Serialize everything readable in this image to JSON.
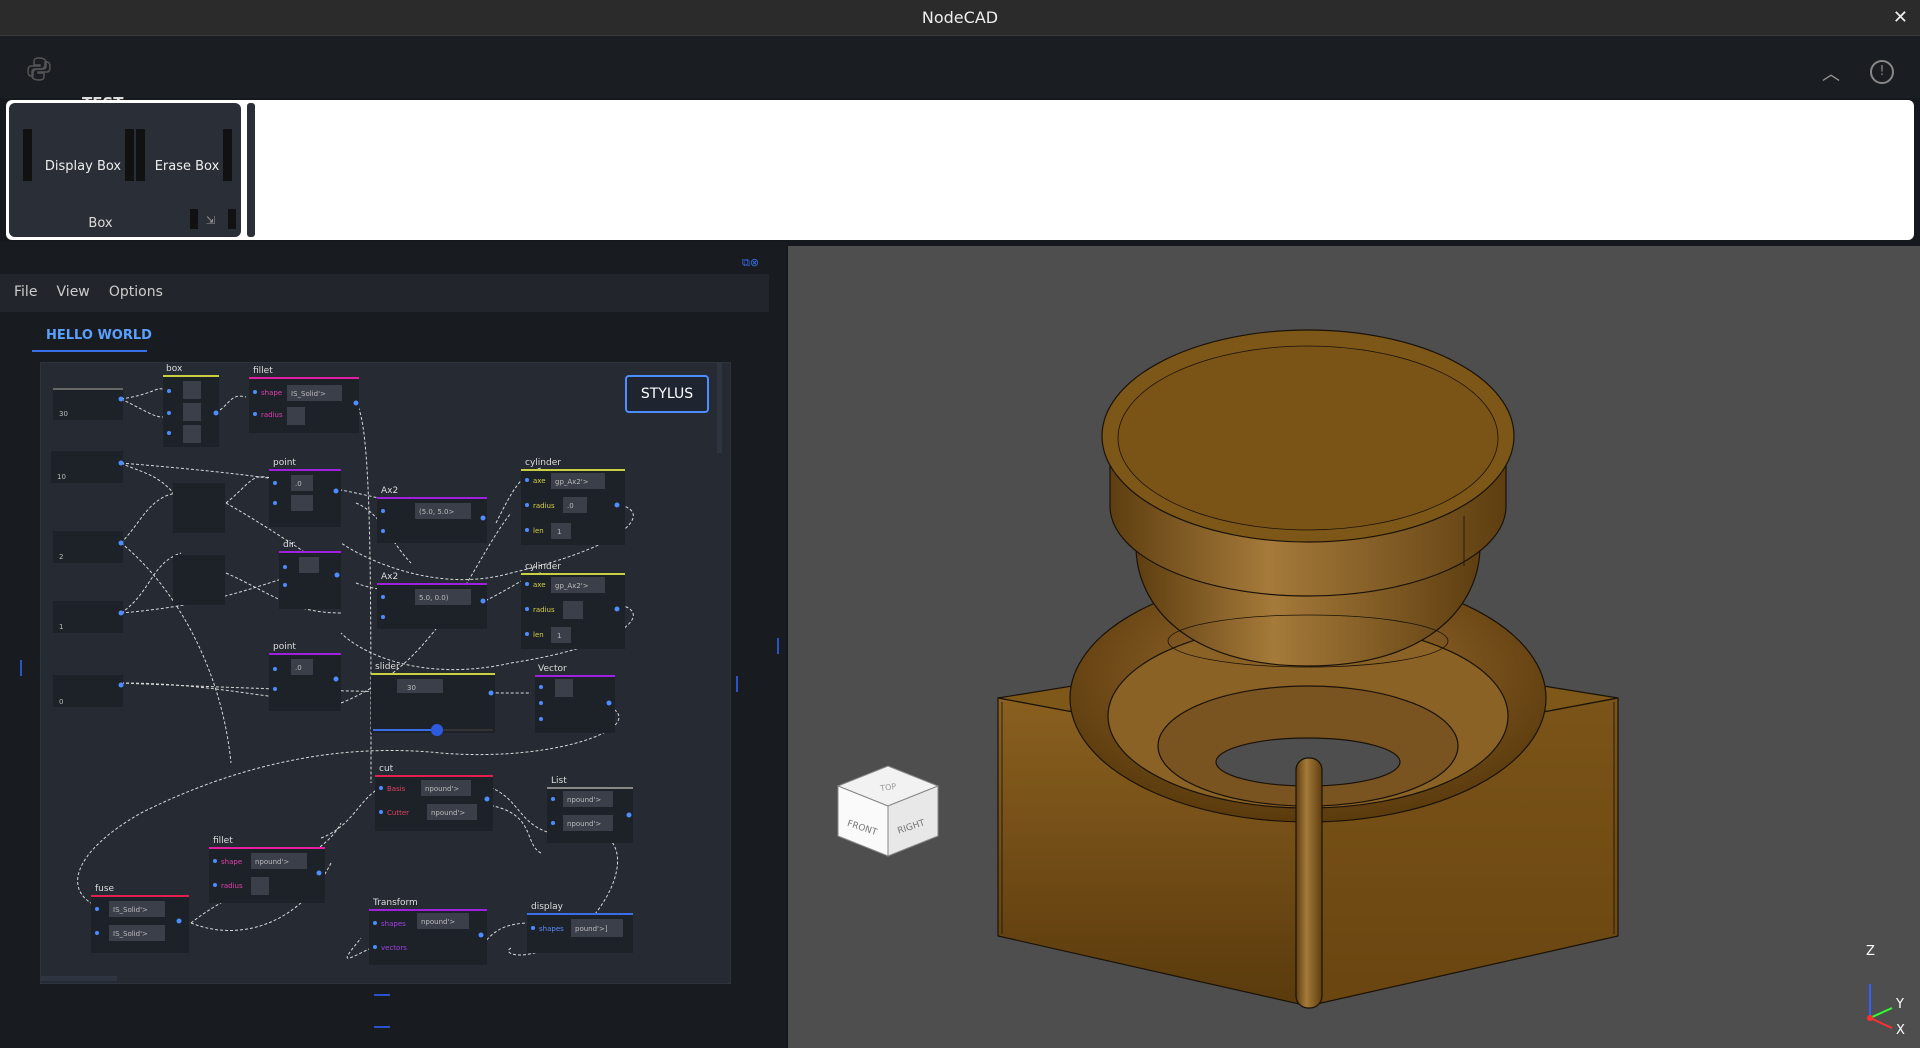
{
  "window": {
    "title": "NodeCAD"
  },
  "ribbon": {
    "tab": "TEST",
    "group": {
      "label": "Box",
      "display_button": "Display Box",
      "erase_button": "Erase Box"
    }
  },
  "editor": {
    "menu": [
      "File",
      "View",
      "Options"
    ],
    "graph_tab": "HELLO WORLD",
    "stylus_button": "STYLUS",
    "inputs": [
      "30",
      "10",
      "2",
      "1",
      "0"
    ],
    "nodes": {
      "box": {
        "title": "box"
      },
      "fillet_top": {
        "title": "fillet",
        "ports": [
          "shape",
          "radius"
        ],
        "shape_value": "IS_Solid'>"
      },
      "point1": {
        "title": "point",
        "value": ".0"
      },
      "ax2_1": {
        "title": "Ax2",
        "value": "(5.0, 5.0>"
      },
      "ax2_2": {
        "title": "Ax2",
        "value": "5.0, 0.0)"
      },
      "dir": {
        "title": "dir"
      },
      "point2": {
        "title": "point",
        "value": ".0"
      },
      "cylinder1": {
        "title": "cylinder",
        "ports": [
          "axe",
          "radius",
          "len"
        ],
        "axe_value": "gp_Ax2'>",
        "radius_value": ".0",
        "len_value": "1"
      },
      "cylinder2": {
        "title": "cylinder",
        "ports": [
          "axe",
          "radius",
          "len"
        ],
        "axe_value": "gp_Ax2'>",
        "len_value": "1"
      },
      "slider": {
        "title": "slider",
        "value": "30"
      },
      "vector": {
        "title": "Vector"
      },
      "cut": {
        "title": "cut",
        "ports": [
          "Basis",
          "Cutter"
        ],
        "value": "npound'>"
      },
      "list": {
        "title": "List",
        "value": "npound'>"
      },
      "fillet_bottom": {
        "title": "fillet",
        "ports": [
          "shape",
          "radius"
        ],
        "shape_value": "npound'>"
      },
      "fuse": {
        "title": "fuse",
        "value": "IS_Solid'>"
      },
      "transform": {
        "title": "Transform",
        "ports": [
          "shapes",
          "vectors"
        ],
        "value": "npound'>"
      },
      "display": {
        "title": "display",
        "ports": [
          "shapes"
        ],
        "value": "pound'>]"
      }
    }
  },
  "viewer": {
    "view_cube": {
      "top": "TOP",
      "front": "FRONT",
      "right": "RIGHT"
    },
    "axes": {
      "z": "Z",
      "y": "Y",
      "x": "X"
    },
    "colors": {
      "model": "#7a5418",
      "background": "#4e4e4e",
      "axis_x": "#ff3030",
      "axis_y": "#30ff30",
      "axis_z": "#3060ff"
    }
  }
}
